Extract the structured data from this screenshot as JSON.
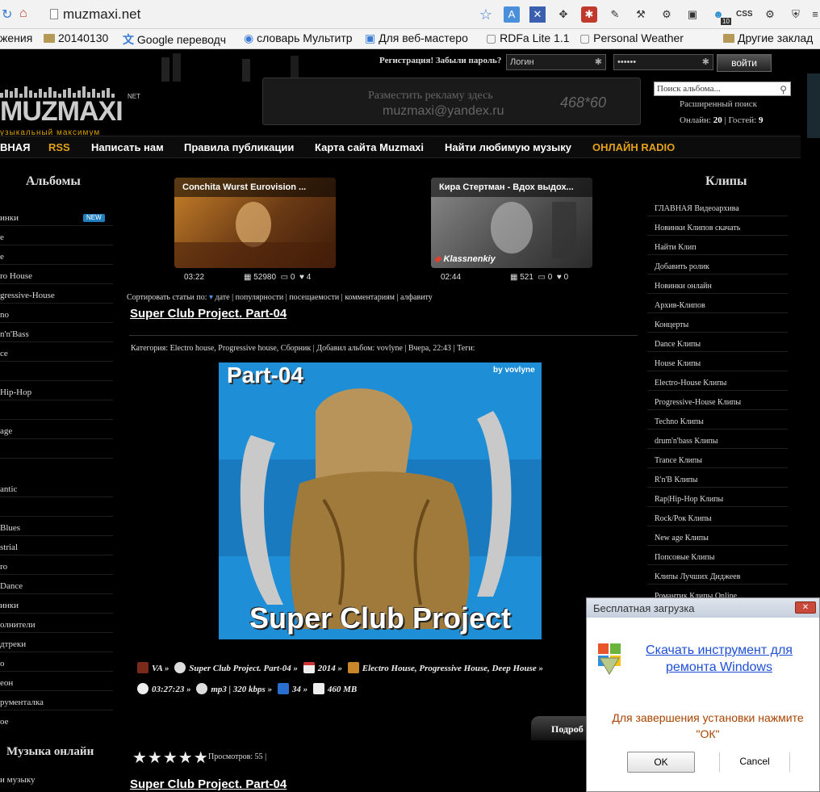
{
  "browser": {
    "url": "muzmaxi.net",
    "bookmarks": [
      {
        "label": "жения",
        "icon": "page-icon"
      },
      {
        "label": "20140130",
        "icon": "folder-icon"
      },
      {
        "label": "Google переводч",
        "icon": "translate-icon"
      },
      {
        "label": "словарь Мультитр",
        "icon": "globe-icon"
      },
      {
        "label": "Для веб-мастеро",
        "icon": "bookmark-icon"
      },
      {
        "label": "RDFa Lite 1.1",
        "icon": "page-icon"
      },
      {
        "label": "Personal Weather",
        "icon": "page-icon"
      },
      {
        "label": "Другие заклад",
        "icon": "folder-icon"
      }
    ],
    "css_ext": "CSS",
    "badge_count": "10"
  },
  "header": {
    "auth_text": "Регистрация! Забыли пароль?",
    "login_placeholder": "Логин",
    "password_value": "••••••",
    "login_button": "войти",
    "logo": "MUZMAXI",
    "logo_net": "NET",
    "logo_sub": "узыкальный максимум",
    "ad_line1": "Разместить рекламу здесь",
    "ad_line2": "muzmaxi@yandex.ru",
    "ad_size": "468*60",
    "search_placeholder": "Поиск альбома...",
    "advanced_search": "Расширенный поиск",
    "online_label": "Онлайн:",
    "online_count": "20",
    "guests_label": "| Гостей:",
    "guests_count": "9"
  },
  "nav": {
    "items": [
      "ВНАЯ",
      "RSS",
      "Написать нам",
      "Правила публикации",
      "Карта сайта Muzmaxi",
      "Найти любимую музыку",
      "ОНЛАЙН RADIO"
    ],
    "accent": "#e3a21a"
  },
  "left": {
    "heading": "Альбомы",
    "new_badge": "NEW",
    "items": [
      "инки",
      "е",
      "е",
      "ro House",
      "gressive-House",
      "no",
      "n'n'Bass",
      "ce",
      "",
      "Hip-Hop",
      "",
      "age",
      "",
      "antic",
      "",
      "Blues",
      "strial",
      "ro",
      "Dance",
      "инки",
      "олнители",
      "дтреки",
      "о",
      "еон",
      "рументалка",
      "ое"
    ],
    "online_heading": "Музыка онлайн",
    "online_item": "и музыку"
  },
  "right": {
    "heading": "Клипы",
    "items": [
      "ГЛАВНАЯ Видеоархива",
      "Новинки Клипов скачать",
      "Найти Клип",
      "Добавить ролик",
      "Новинки онлайн",
      "Архив-Клипов",
      "Концерты",
      "Dance Клипы",
      "House Клипы",
      "Electro-House Клипы",
      "Progressive-House Клипы",
      "Techno Клипы",
      "drum'n'bass Клипы",
      "Trance Клипы",
      "R'n'B Клипы",
      "Rap|Hip-Hop Клипы",
      "Rock/Рок Клипы",
      "New age Клипы",
      "Попсовые Клипы",
      "Клипы Лучших Диджеев",
      "Романтик Клипы Online"
    ]
  },
  "videos": [
    {
      "title": "Conchita Wurst Eurovision ...",
      "duration": "03:22",
      "views": "52980",
      "comments": "0",
      "likes": "4",
      "watermark": ""
    },
    {
      "title": "Кира Стертман - Вдох выдох...",
      "duration": "02:44",
      "views": "521",
      "comments": "0",
      "likes": "0",
      "watermark": "Klassnenkiy"
    }
  ],
  "sort": {
    "label": "Сортировать статьи по:",
    "options": [
      "дате",
      "популярности",
      "посещаемости",
      "комментариям",
      "алфавиту"
    ]
  },
  "post": {
    "title": "Super Club Project. Part-04",
    "category_line": "Категория:  Electro house, Progressive house, Сборник | Добавил альбом: vovlyne | Вчера, 22:43 | Теги:",
    "cover_part": "Part-04",
    "cover_by": "by vovlyne",
    "cover_title": "Super Club Project",
    "artist": "VA »",
    "album": "Super Club Project. Part-04 »",
    "year": "2014 »",
    "genres": "Electro House, Progressive House, Deep House »",
    "duration": "03:27:23 »",
    "format": "mp3 | 320 kbps »",
    "tracks": "34 »",
    "size": "460 MB",
    "more": "Подроб",
    "views_label": "Просмотров: 55 |",
    "stars": "★★★★★",
    "rating": 5
  },
  "post2": {
    "title": "Super Club Project. Part-04"
  },
  "popup": {
    "title": "Бесплатная загрузка",
    "link": "Скачать инструмент для ремонта Windows",
    "message": "Для завершения установки нажмите \"ОК\"",
    "ok": "OK",
    "cancel": "Cancel"
  }
}
